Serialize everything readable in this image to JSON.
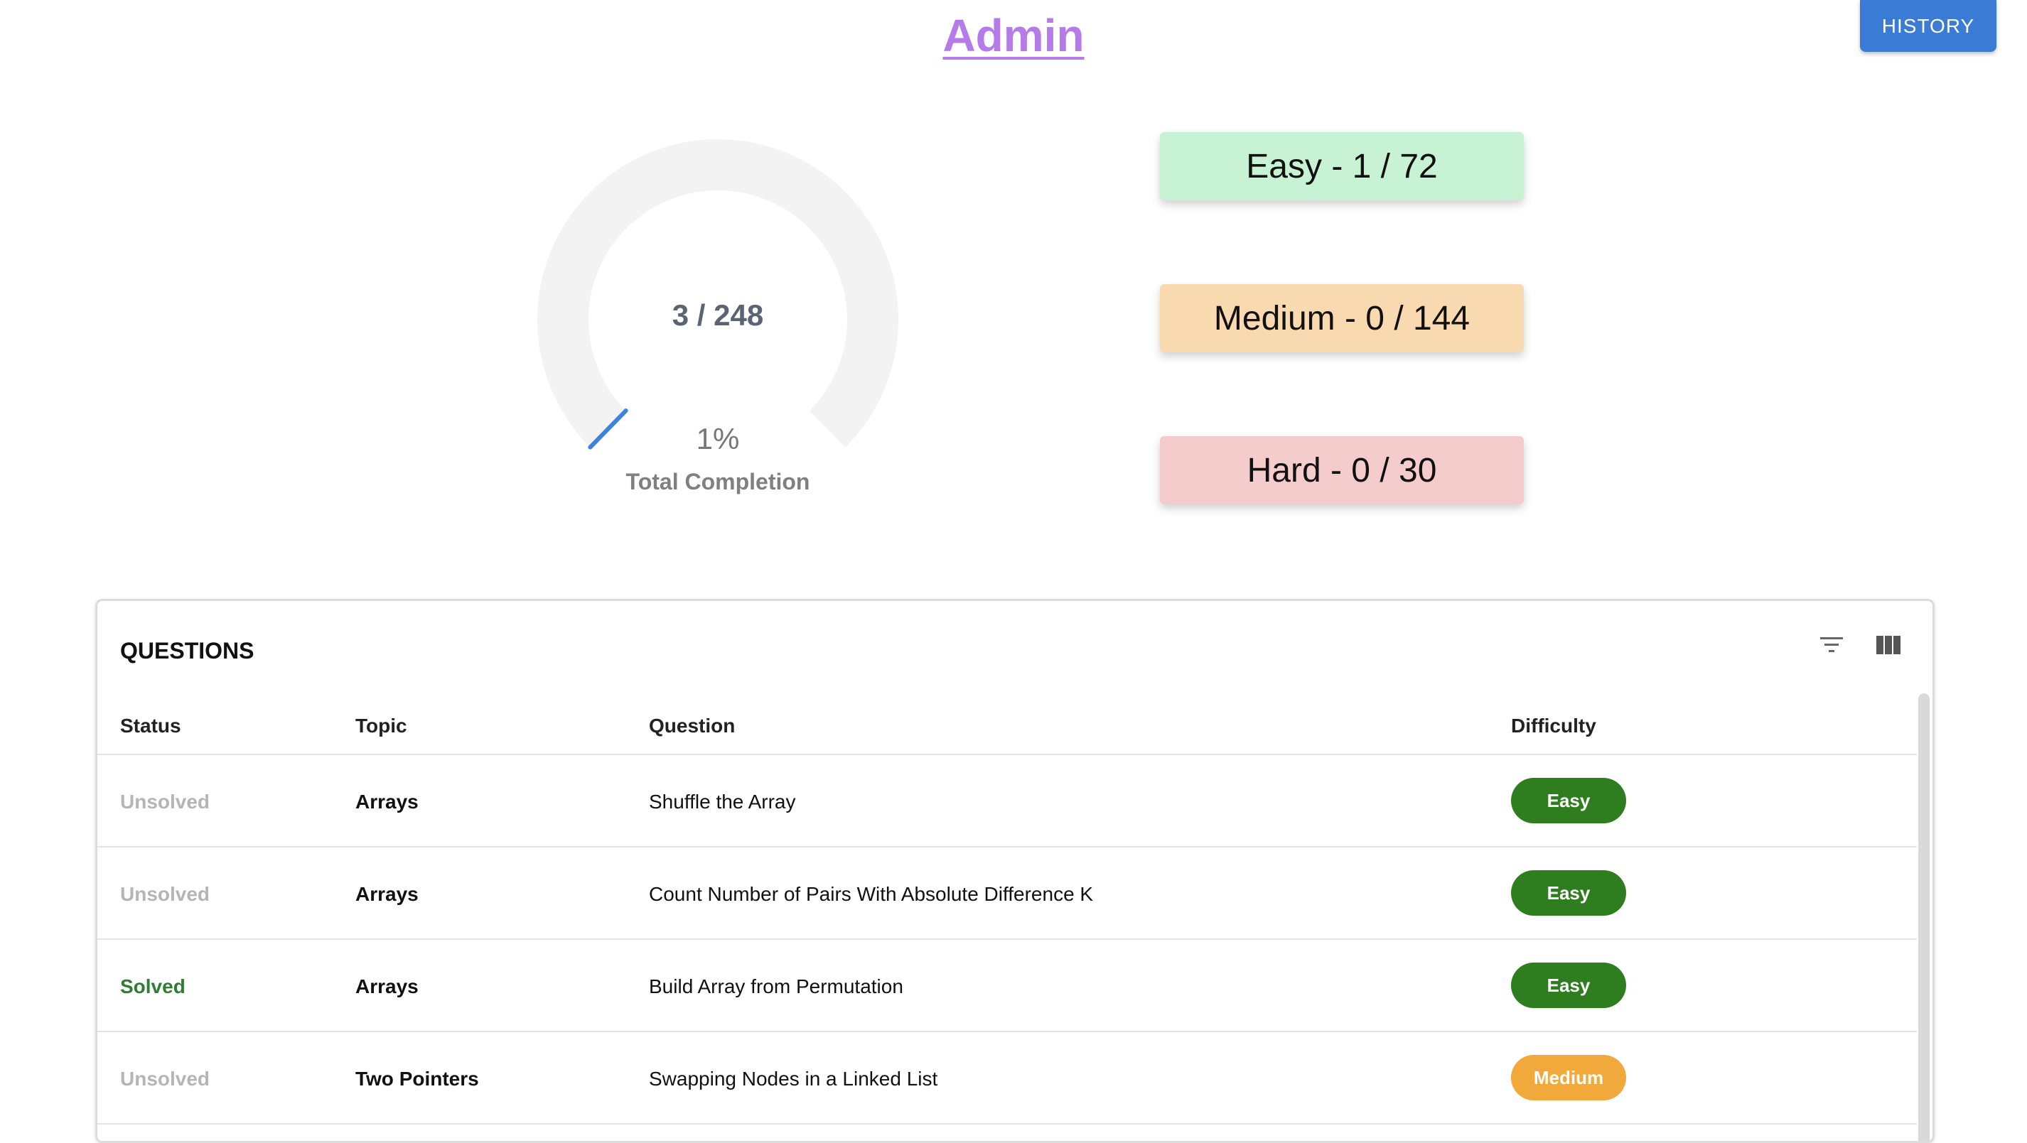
{
  "header": {
    "title": "Admin",
    "title_color": "#b57be8",
    "history_button": "HISTORY",
    "history_button_color": "#3a7bd5"
  },
  "progress": {
    "count_text": "3 / 248",
    "percent_text": "1%",
    "label": "Total Completion",
    "fraction": 0.01,
    "track_color": "#f3f3f3",
    "fill_color": "#3a84e0"
  },
  "difficulty_cards": [
    {
      "label": "Easy - 1 / 72",
      "color": "#c8f2d4"
    },
    {
      "label": "Medium - 0 / 144",
      "color": "#f8d9b0"
    },
    {
      "label": "Hard - 0 / 30",
      "color": "#f4cccc"
    }
  ],
  "questions_panel": {
    "title": "QUESTIONS",
    "toolbar_icons": [
      "filter-icon",
      "columns-icon"
    ],
    "columns": [
      "Status",
      "Topic",
      "Question",
      "Difficulty"
    ],
    "rows": [
      {
        "status": "Unsolved",
        "topic": "Arrays",
        "question": "Shuffle the Array",
        "difficulty": "Easy"
      },
      {
        "status": "Unsolved",
        "topic": "Arrays",
        "question": "Count Number of Pairs With Absolute Difference K",
        "difficulty": "Easy"
      },
      {
        "status": "Solved",
        "topic": "Arrays",
        "question": "Build Array from Permutation",
        "difficulty": "Easy"
      },
      {
        "status": "Unsolved",
        "topic": "Two Pointers",
        "question": "Swapping Nodes in a Linked List",
        "difficulty": "Medium"
      }
    ],
    "status_colors": {
      "Unsolved": "#b5b5b5",
      "Solved": "#2e7d32"
    },
    "difficulty_colors": {
      "Easy": "#2e7d1f",
      "Medium": "#f2a93b",
      "Hard": "#d32f2f"
    }
  }
}
